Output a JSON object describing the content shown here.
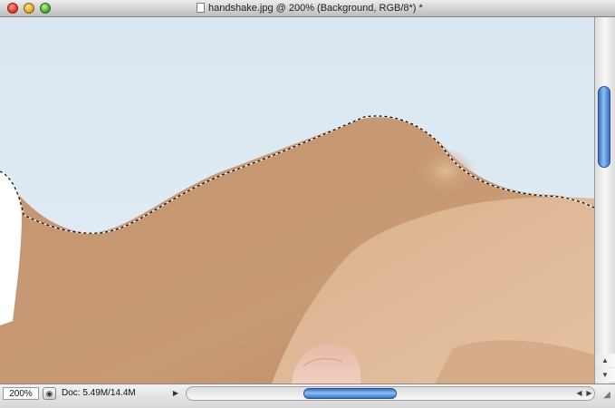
{
  "window": {
    "title": "handshake.jpg @ 200% (Background, RGB/8*) *"
  },
  "status_bar": {
    "zoom": "200%",
    "doc_info": "Doc: 5.49M/14.4M"
  },
  "icons": {
    "close": "close-button",
    "minimize": "minimize-button",
    "zoom": "zoom-button",
    "document": "document-proxy-icon",
    "status_options": "status-arrow-icon",
    "scroll_up": "arrow-up-icon",
    "scroll_down": "arrow-down-icon",
    "scroll_left": "arrow-left-icon",
    "scroll_right": "arrow-right-icon",
    "resize": "resize-grip-icon"
  },
  "colors": {
    "background_sky": "#dde9f2",
    "skin": "#c8996d",
    "selection_marquee": "#000000",
    "scroll_thumb": "#5b95e2"
  }
}
